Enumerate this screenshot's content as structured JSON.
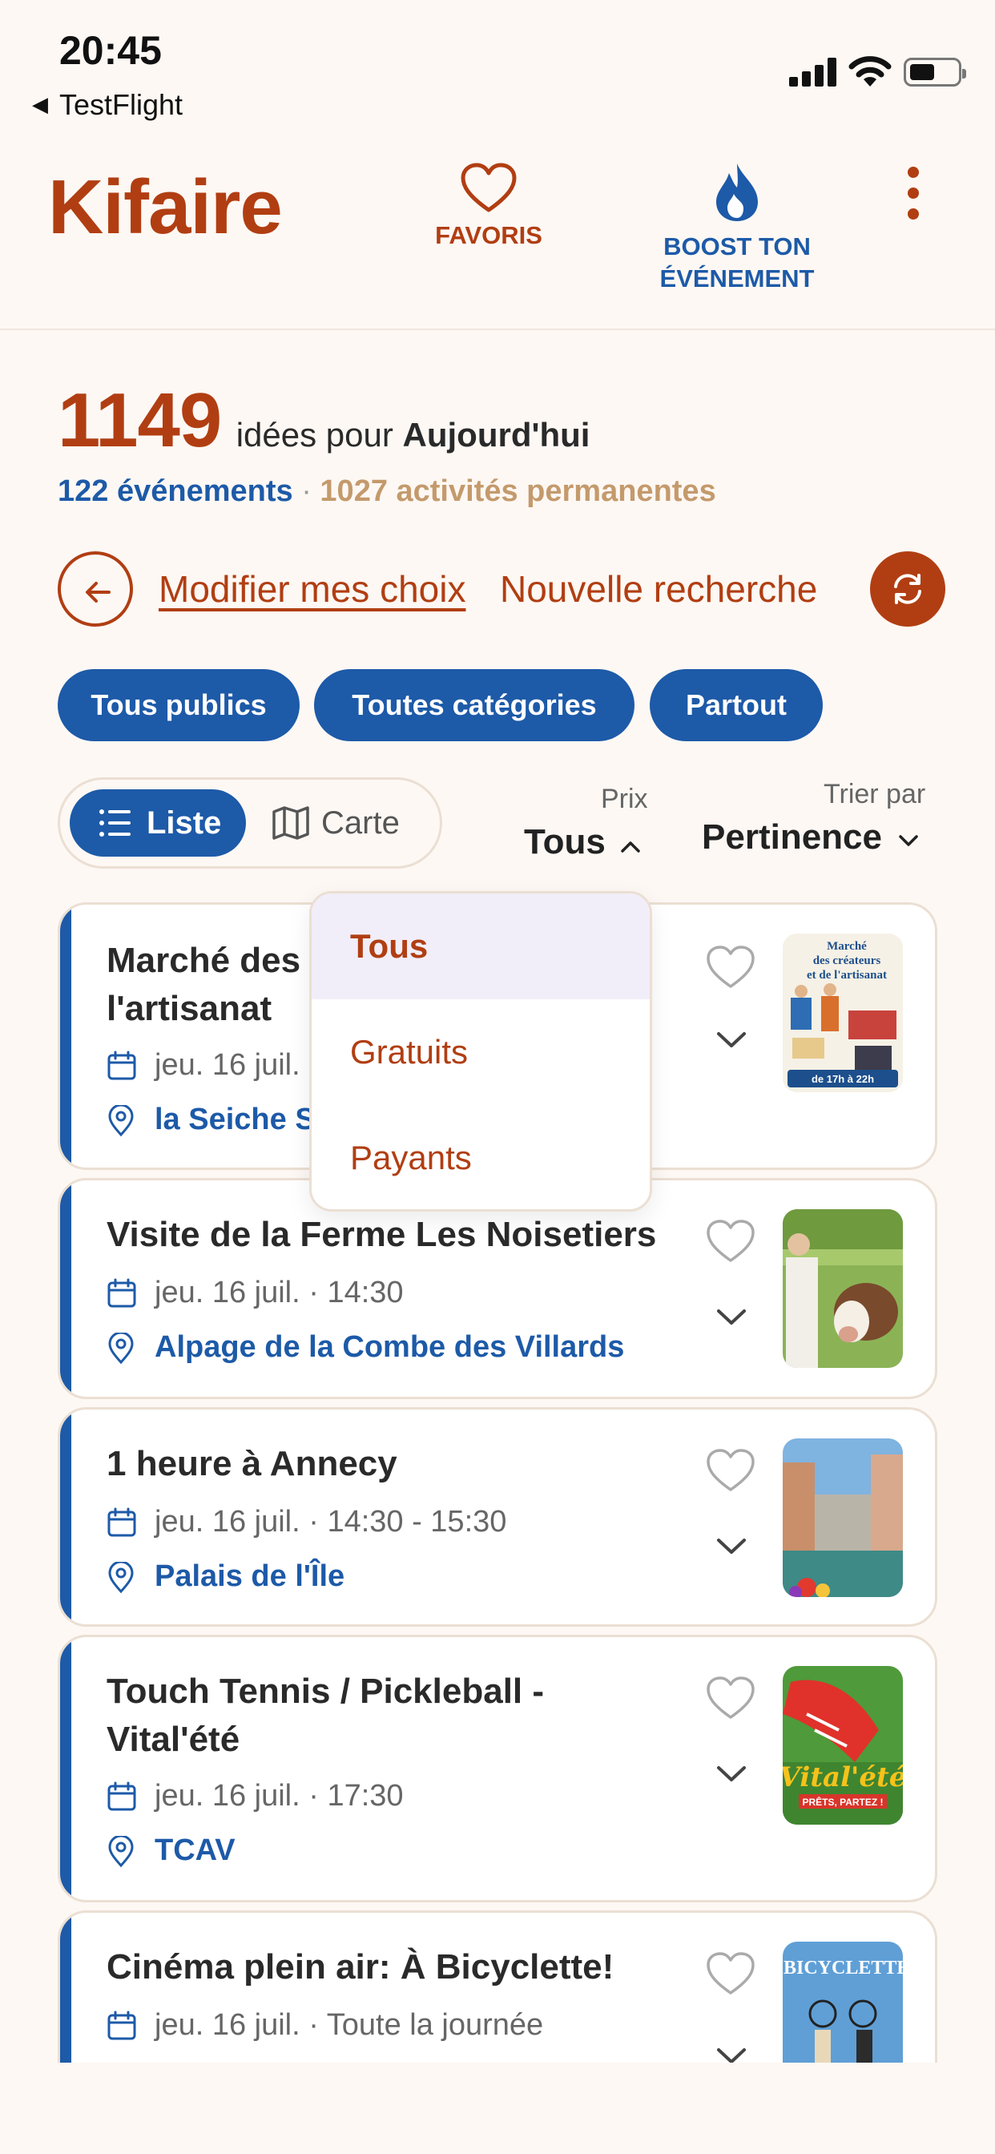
{
  "status_bar": {
    "time": "20:45",
    "back_app": "TestFlight"
  },
  "header": {
    "logo": "Kifaire",
    "favoris_label": "FAVORIS",
    "boost_line1": "BOOST TON",
    "boost_line2": "ÉVÉNEMENT"
  },
  "summary": {
    "count": "1149",
    "count_text": "idées pour",
    "period": "Aujourd'hui",
    "events": "122 événements",
    "separator": "·",
    "permanent": "1027 activités permanentes"
  },
  "actions": {
    "modify": "Modifier mes choix",
    "new_search": "Nouvelle recherche"
  },
  "filters": {
    "chips": [
      "Tous publics",
      "Toutes catégories",
      "Partout"
    ]
  },
  "view_toggle": {
    "list": "Liste",
    "map": "Carte"
  },
  "price": {
    "label": "Prix",
    "value": "Tous"
  },
  "sort": {
    "label": "Trier par",
    "value": "Pertinence"
  },
  "price_dropdown": {
    "options": [
      "Tous",
      "Gratuits",
      "Payants"
    ],
    "selected": "Tous"
  },
  "events": [
    {
      "title_line1": "Marché des créateurs et de",
      "title_line2": "l'artisanat",
      "date": "jeu. 16 juil.",
      "location": "la Seiche Sucrier"
    },
    {
      "title": "Visite de la Ferme Les Noisetiers",
      "date": "jeu. 16 juil. · 14:30",
      "location": "Alpage de la Combe des Villards"
    },
    {
      "title": "1 heure à Annecy",
      "date": "jeu. 16 juil. · 14:30 - 15:30",
      "location": "Palais de l'Île"
    },
    {
      "title_line1": "Touch Tennis / Pickleball -",
      "title_line2": "Vital'été",
      "date": "jeu. 16 juil. · 17:30",
      "location": "TCAV"
    },
    {
      "title": "Cinéma plein air: À Bicyclette!",
      "date": "jeu. 16 juil. · Toute la journée",
      "location": ""
    }
  ],
  "thumb_texts": {
    "poster1_title": "Marché des créateurs et de l'artisanat",
    "poster1_time": "de 17h à 22h",
    "poster4_text": "Vital'été",
    "poster4_sub": "PRÊTS, PARTEZ !",
    "poster5_text": "À BICYCLETTE !"
  },
  "colors": {
    "brand": "#b13e12",
    "blue": "#1d5aa8",
    "background": "#fdf8f4",
    "tan": "#c49a6c"
  }
}
